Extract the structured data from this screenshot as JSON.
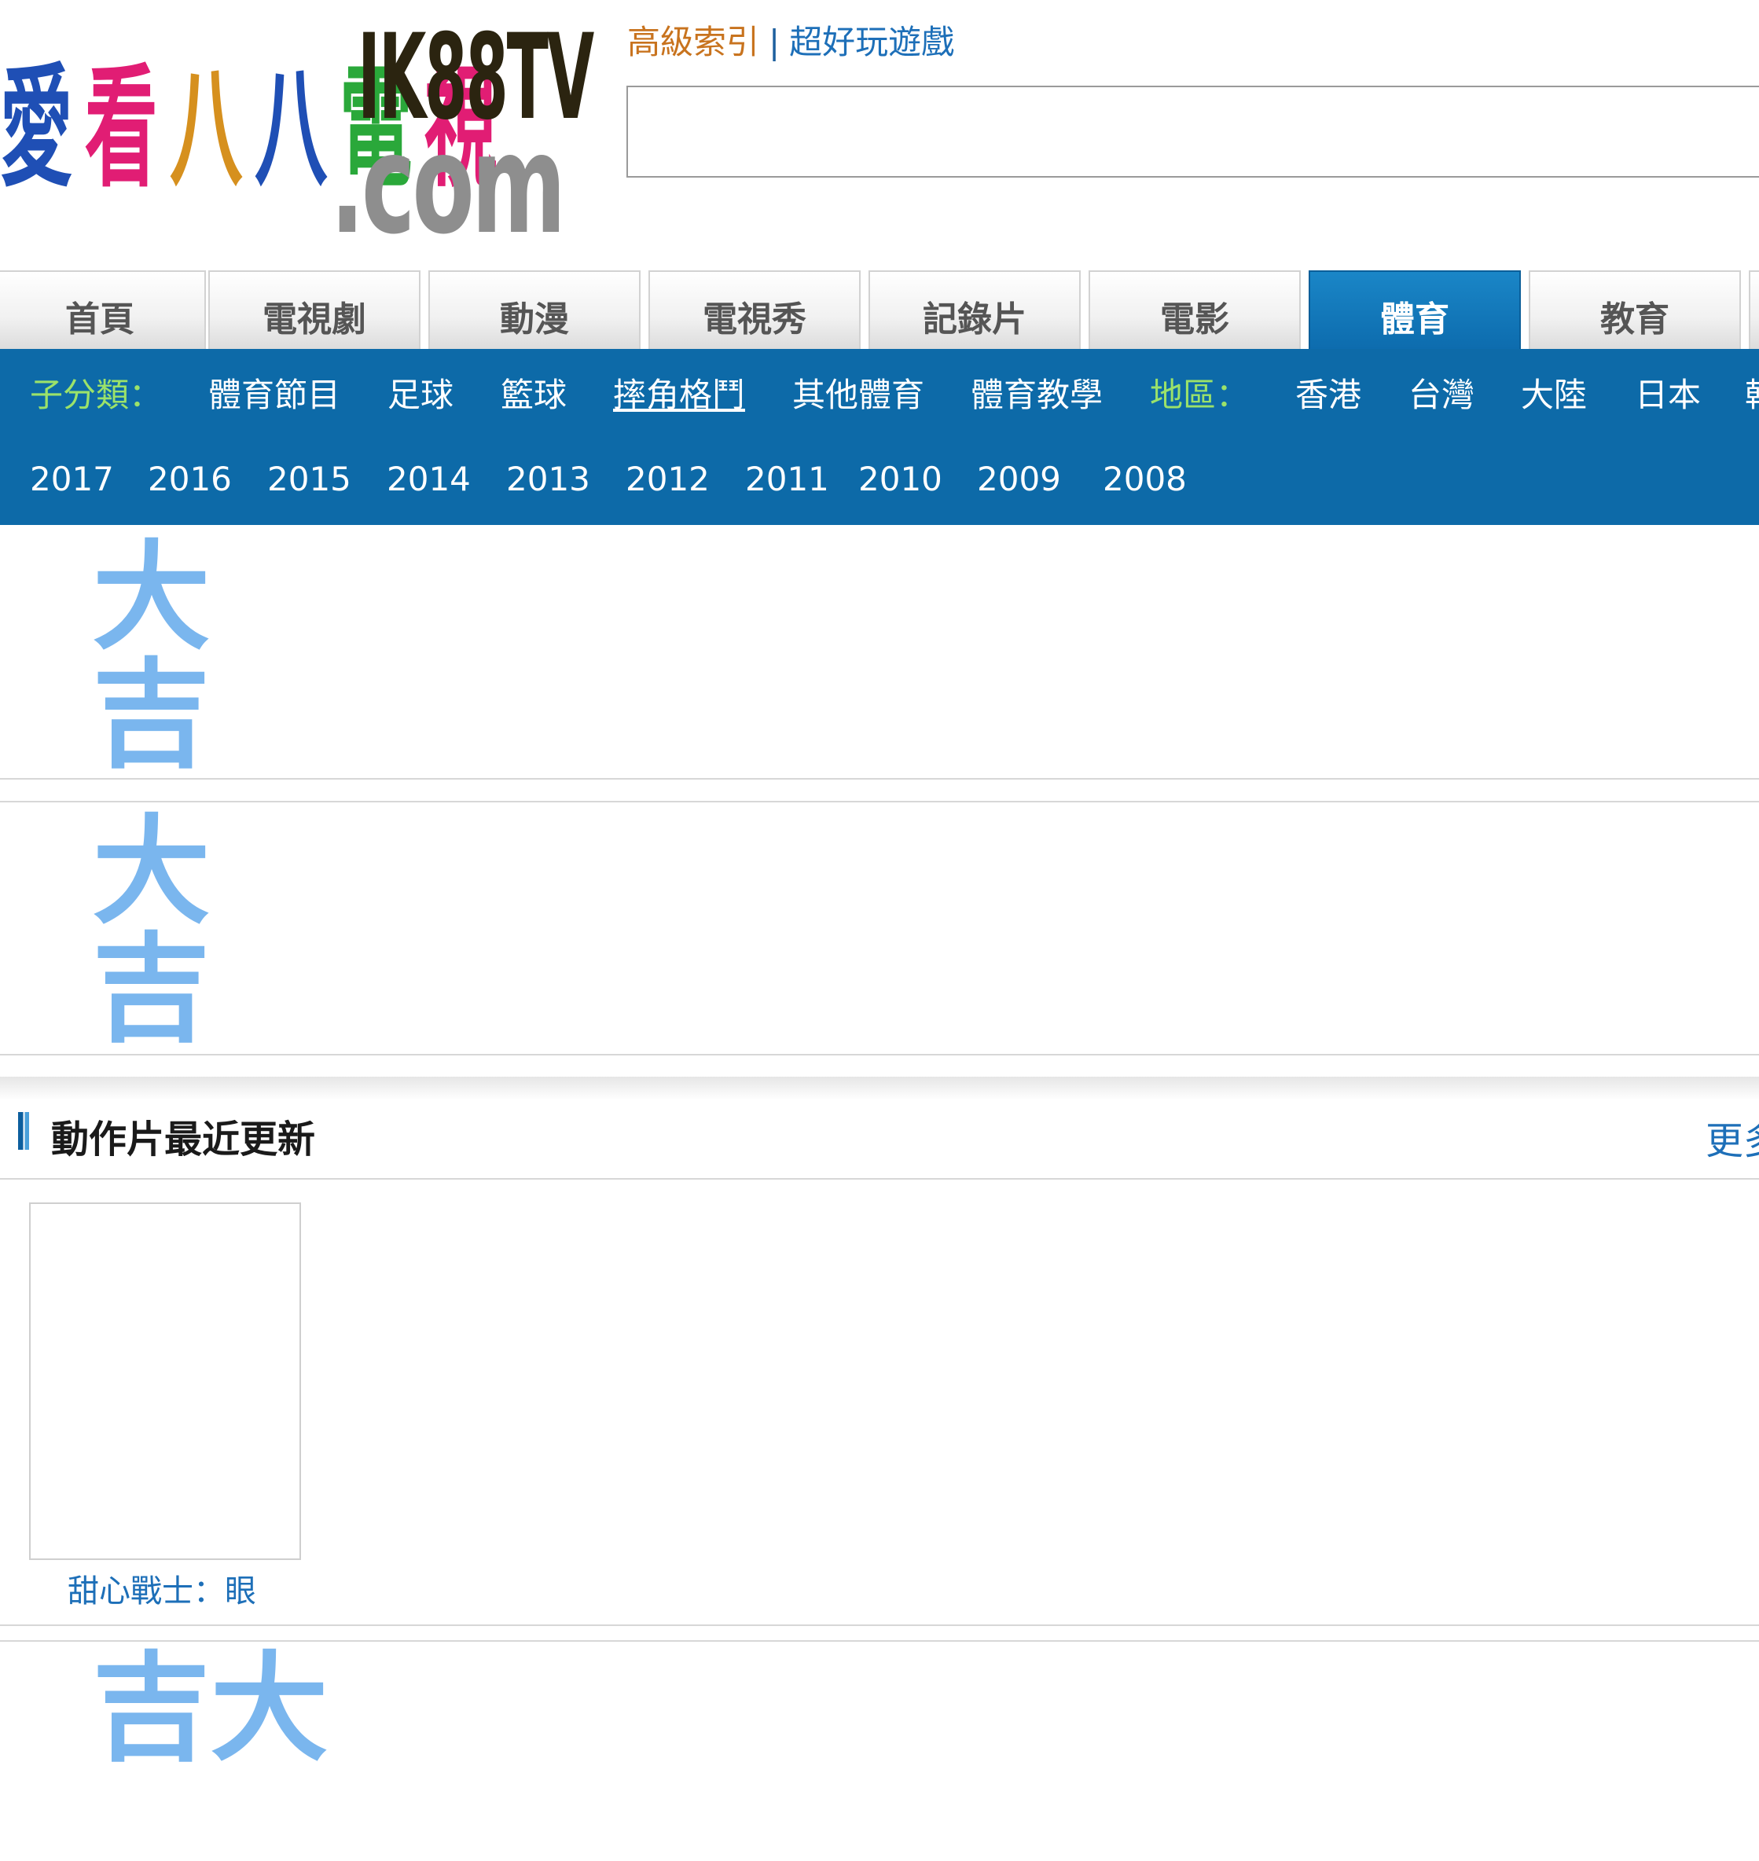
{
  "logo": {
    "chinese_chars": [
      "愛",
      "看",
      "八",
      "八",
      "電",
      "視"
    ],
    "chinese_colors": [
      "#1f4fb5",
      "#e11d74",
      "#d6901e",
      "#1f4fb5",
      "#2aa83a",
      "#e11d74"
    ],
    "en_top": "IK88TV",
    "en_bottom": ".com"
  },
  "toplinks": {
    "advanced": "高級索引",
    "separator": "|",
    "games": "超好玩遊戲"
  },
  "search": {
    "value": ""
  },
  "tabs": [
    {
      "label": "首頁",
      "active": false
    },
    {
      "label": "電視劇",
      "active": false
    },
    {
      "label": "動漫",
      "active": false
    },
    {
      "label": "電視秀",
      "active": false
    },
    {
      "label": "記錄片",
      "active": false
    },
    {
      "label": "電影",
      "active": false
    },
    {
      "label": "體育",
      "active": true
    },
    {
      "label": "教育",
      "active": false
    }
  ],
  "filters": {
    "sub_label": "子分類：",
    "sub_items": [
      "體育節目",
      "足球",
      "籃球",
      "摔角格鬥",
      "其他體育",
      "體育教學"
    ],
    "region_label": "地區：",
    "regions": [
      "香港",
      "台灣",
      "大陸",
      "日本",
      "韓"
    ],
    "years": [
      "2017",
      "2016",
      "2015",
      "2014",
      "2013",
      "2012",
      "2011",
      "2010",
      "2009",
      "2008"
    ]
  },
  "ad_glyph": "大吉",
  "section": {
    "title": "動作片最近更新",
    "more": "更多"
  },
  "items": [
    {
      "title": "甜心戰士：眼"
    }
  ]
}
